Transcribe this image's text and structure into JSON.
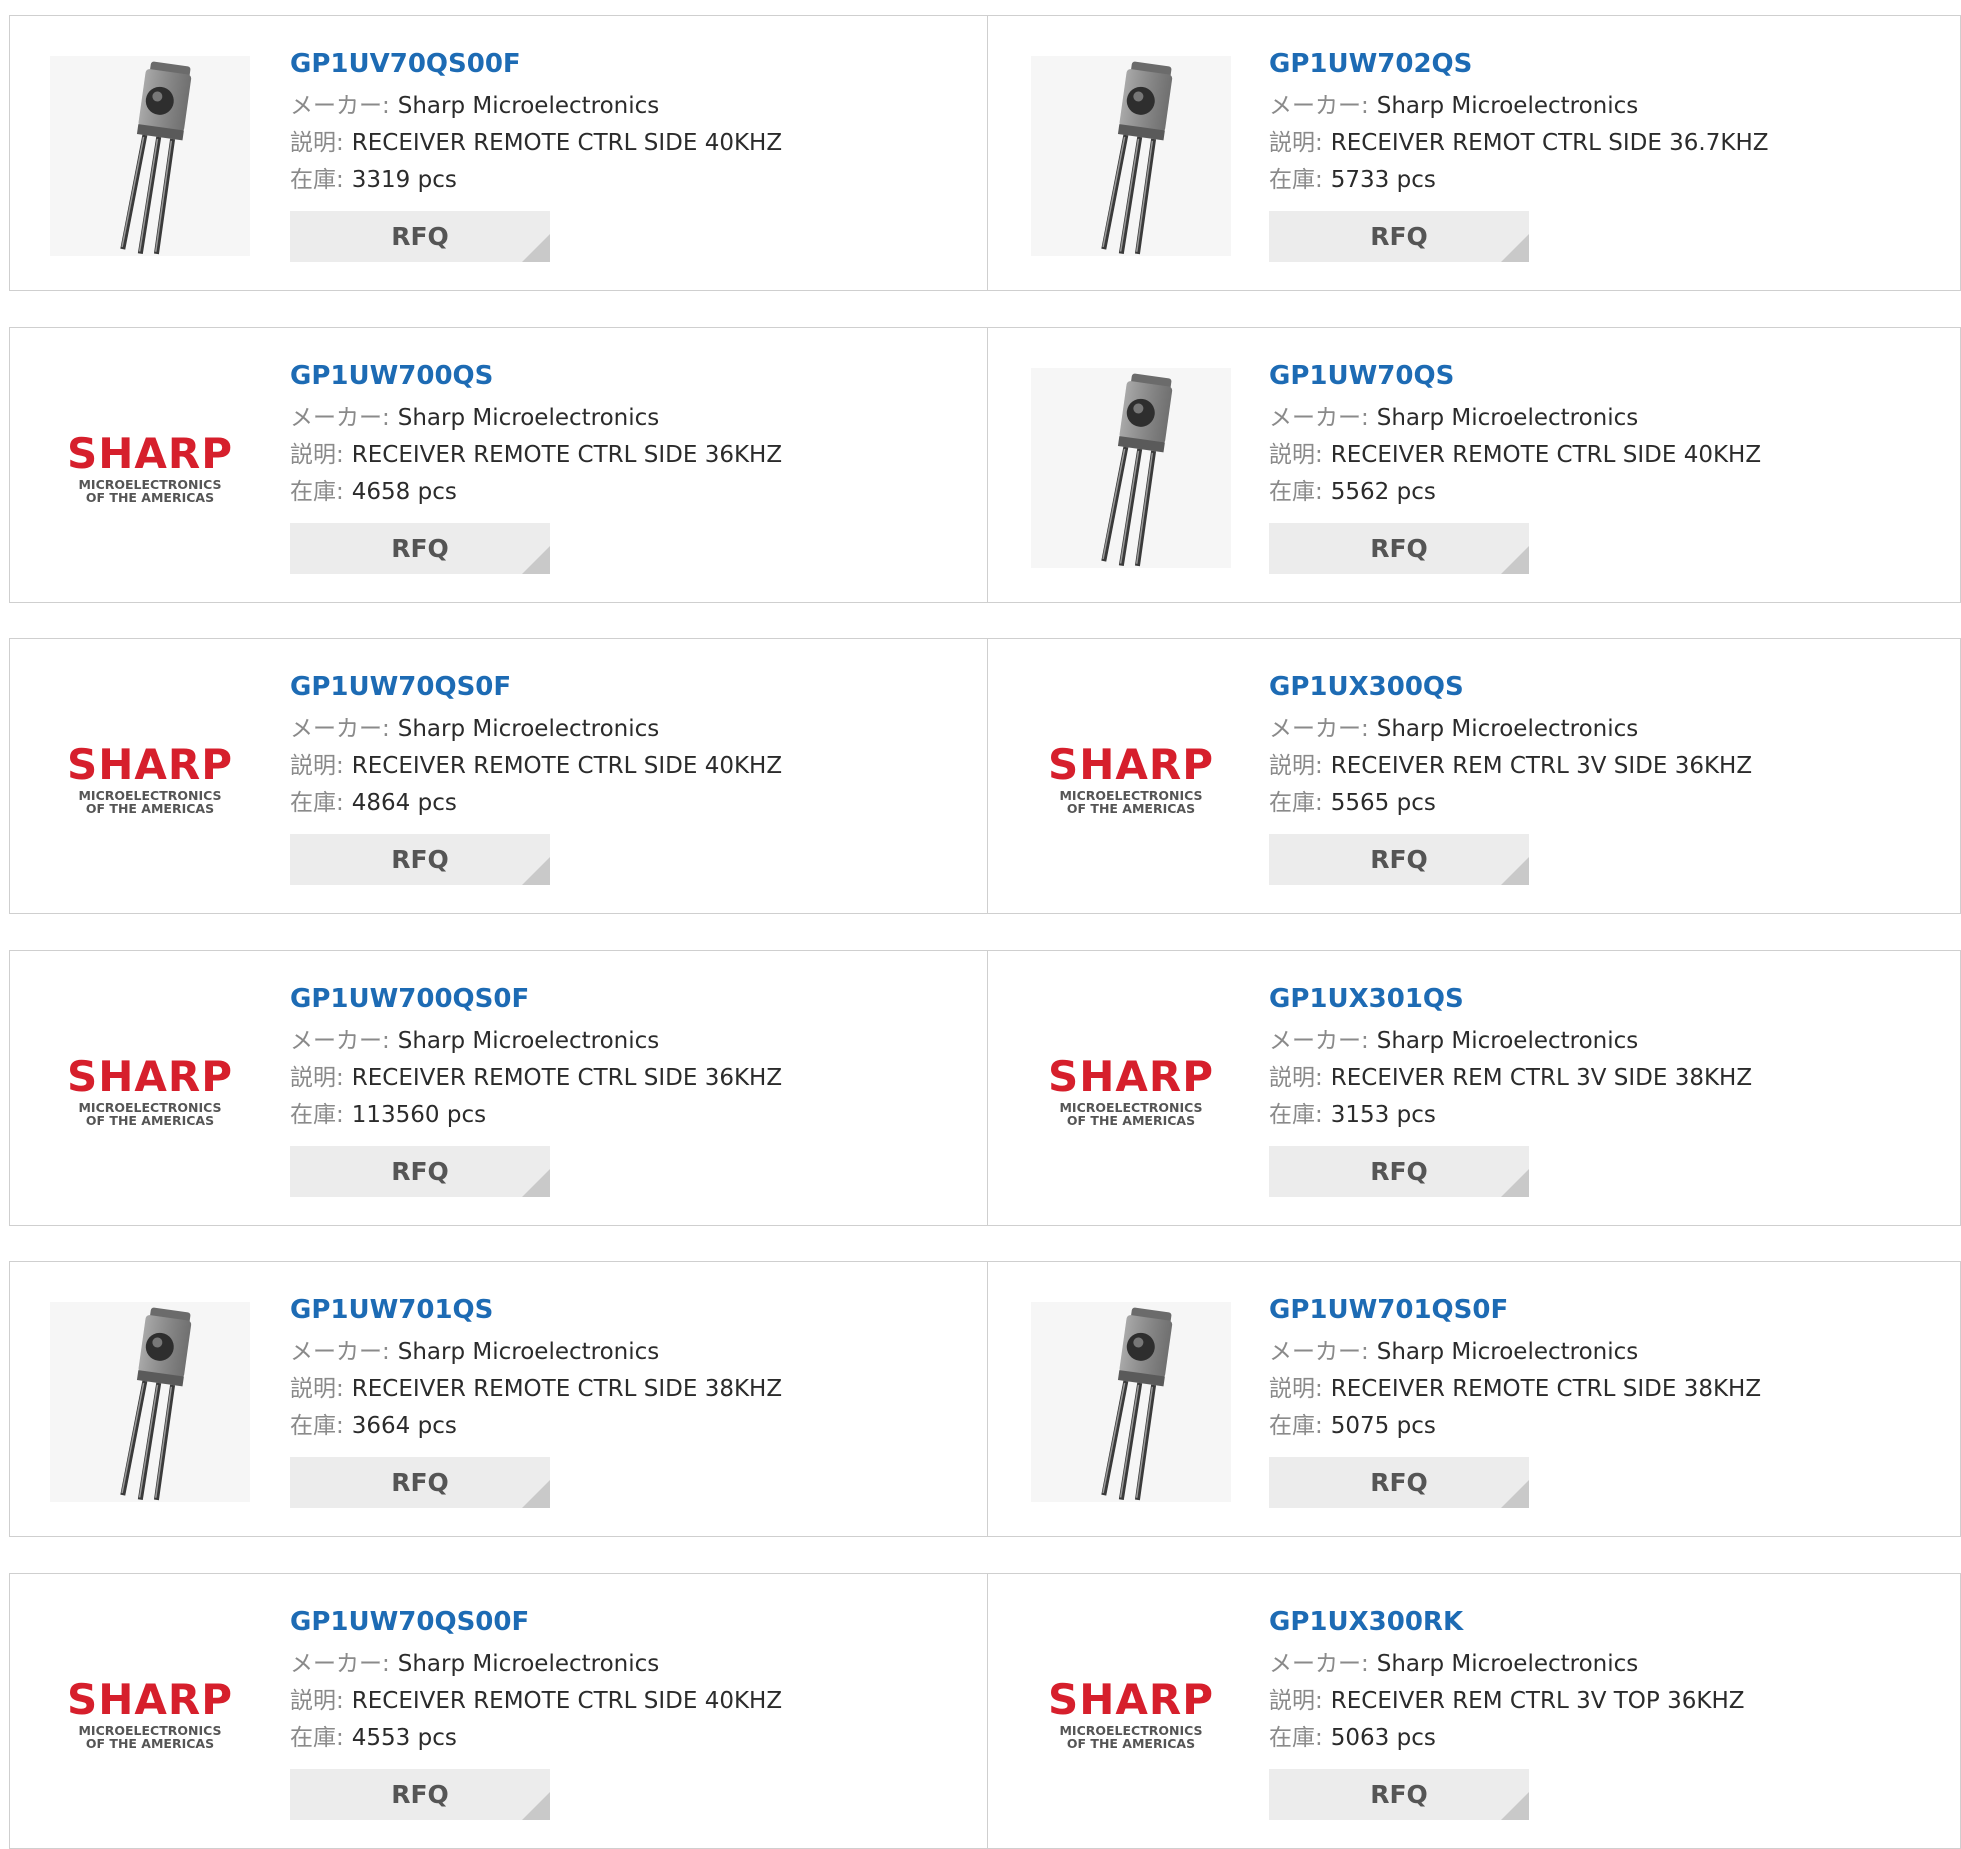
{
  "labels": {
    "maker": "メーカー:",
    "desc": "説明:",
    "stock": "在庫:",
    "rfq": "RFQ"
  },
  "logo": {
    "brand": "SHARP",
    "line1": "MICROELECTRONICS",
    "line2": "OF THE AMERICAS",
    "color": "#d61f2c"
  },
  "products": [
    {
      "part": "GP1UV70QS00F",
      "maker": "Sharp Microelectronics",
      "desc": "RECEIVER REMOTE CTRL SIDE 40KHZ",
      "stock": "3319 pcs",
      "image": "ir-receiver-photo"
    },
    {
      "part": "GP1UW702QS",
      "maker": "Sharp Microelectronics",
      "desc": "RECEIVER REMOT CTRL SIDE 36.7KHZ",
      "stock": "5733 pcs",
      "image": "ir-receiver-photo"
    },
    {
      "part": "GP1UW700QS",
      "maker": "Sharp Microelectronics",
      "desc": "RECEIVER REMOTE CTRL SIDE 36KHZ",
      "stock": "4658 pcs",
      "image": "sharp-logo"
    },
    {
      "part": "GP1UW70QS",
      "maker": "Sharp Microelectronics",
      "desc": "RECEIVER REMOTE CTRL SIDE 40KHZ",
      "stock": "5562 pcs",
      "image": "ir-receiver-photo"
    },
    {
      "part": "GP1UW70QS0F",
      "maker": "Sharp Microelectronics",
      "desc": "RECEIVER REMOTE CTRL SIDE 40KHZ",
      "stock": "4864 pcs",
      "image": "sharp-logo"
    },
    {
      "part": "GP1UX300QS",
      "maker": "Sharp Microelectronics",
      "desc": "RECEIVER REM CTRL 3V SIDE 36KHZ",
      "stock": "5565 pcs",
      "image": "sharp-logo"
    },
    {
      "part": "GP1UW700QS0F",
      "maker": "Sharp Microelectronics",
      "desc": "RECEIVER REMOTE CTRL SIDE 36KHZ",
      "stock": "113560 pcs",
      "image": "sharp-logo"
    },
    {
      "part": "GP1UX301QS",
      "maker": "Sharp Microelectronics",
      "desc": "RECEIVER REM CTRL 3V SIDE 38KHZ",
      "stock": "3153 pcs",
      "image": "sharp-logo"
    },
    {
      "part": "GP1UW701QS",
      "maker": "Sharp Microelectronics",
      "desc": "RECEIVER REMOTE CTRL SIDE 38KHZ",
      "stock": "3664 pcs",
      "image": "ir-receiver-photo"
    },
    {
      "part": "GP1UW701QS0F",
      "maker": "Sharp Microelectronics",
      "desc": "RECEIVER REMOTE CTRL SIDE 38KHZ",
      "stock": "5075 pcs",
      "image": "ir-receiver-photo"
    },
    {
      "part": "GP1UW70QS00F",
      "maker": "Sharp Microelectronics",
      "desc": "RECEIVER REMOTE CTRL SIDE 40KHZ",
      "stock": "4553 pcs",
      "image": "sharp-logo"
    },
    {
      "part": "GP1UX300RK",
      "maker": "Sharp Microelectronics",
      "desc": "RECEIVER REM CTRL 3V TOP 36KHZ",
      "stock": "5063 pcs",
      "image": "sharp-logo"
    }
  ]
}
